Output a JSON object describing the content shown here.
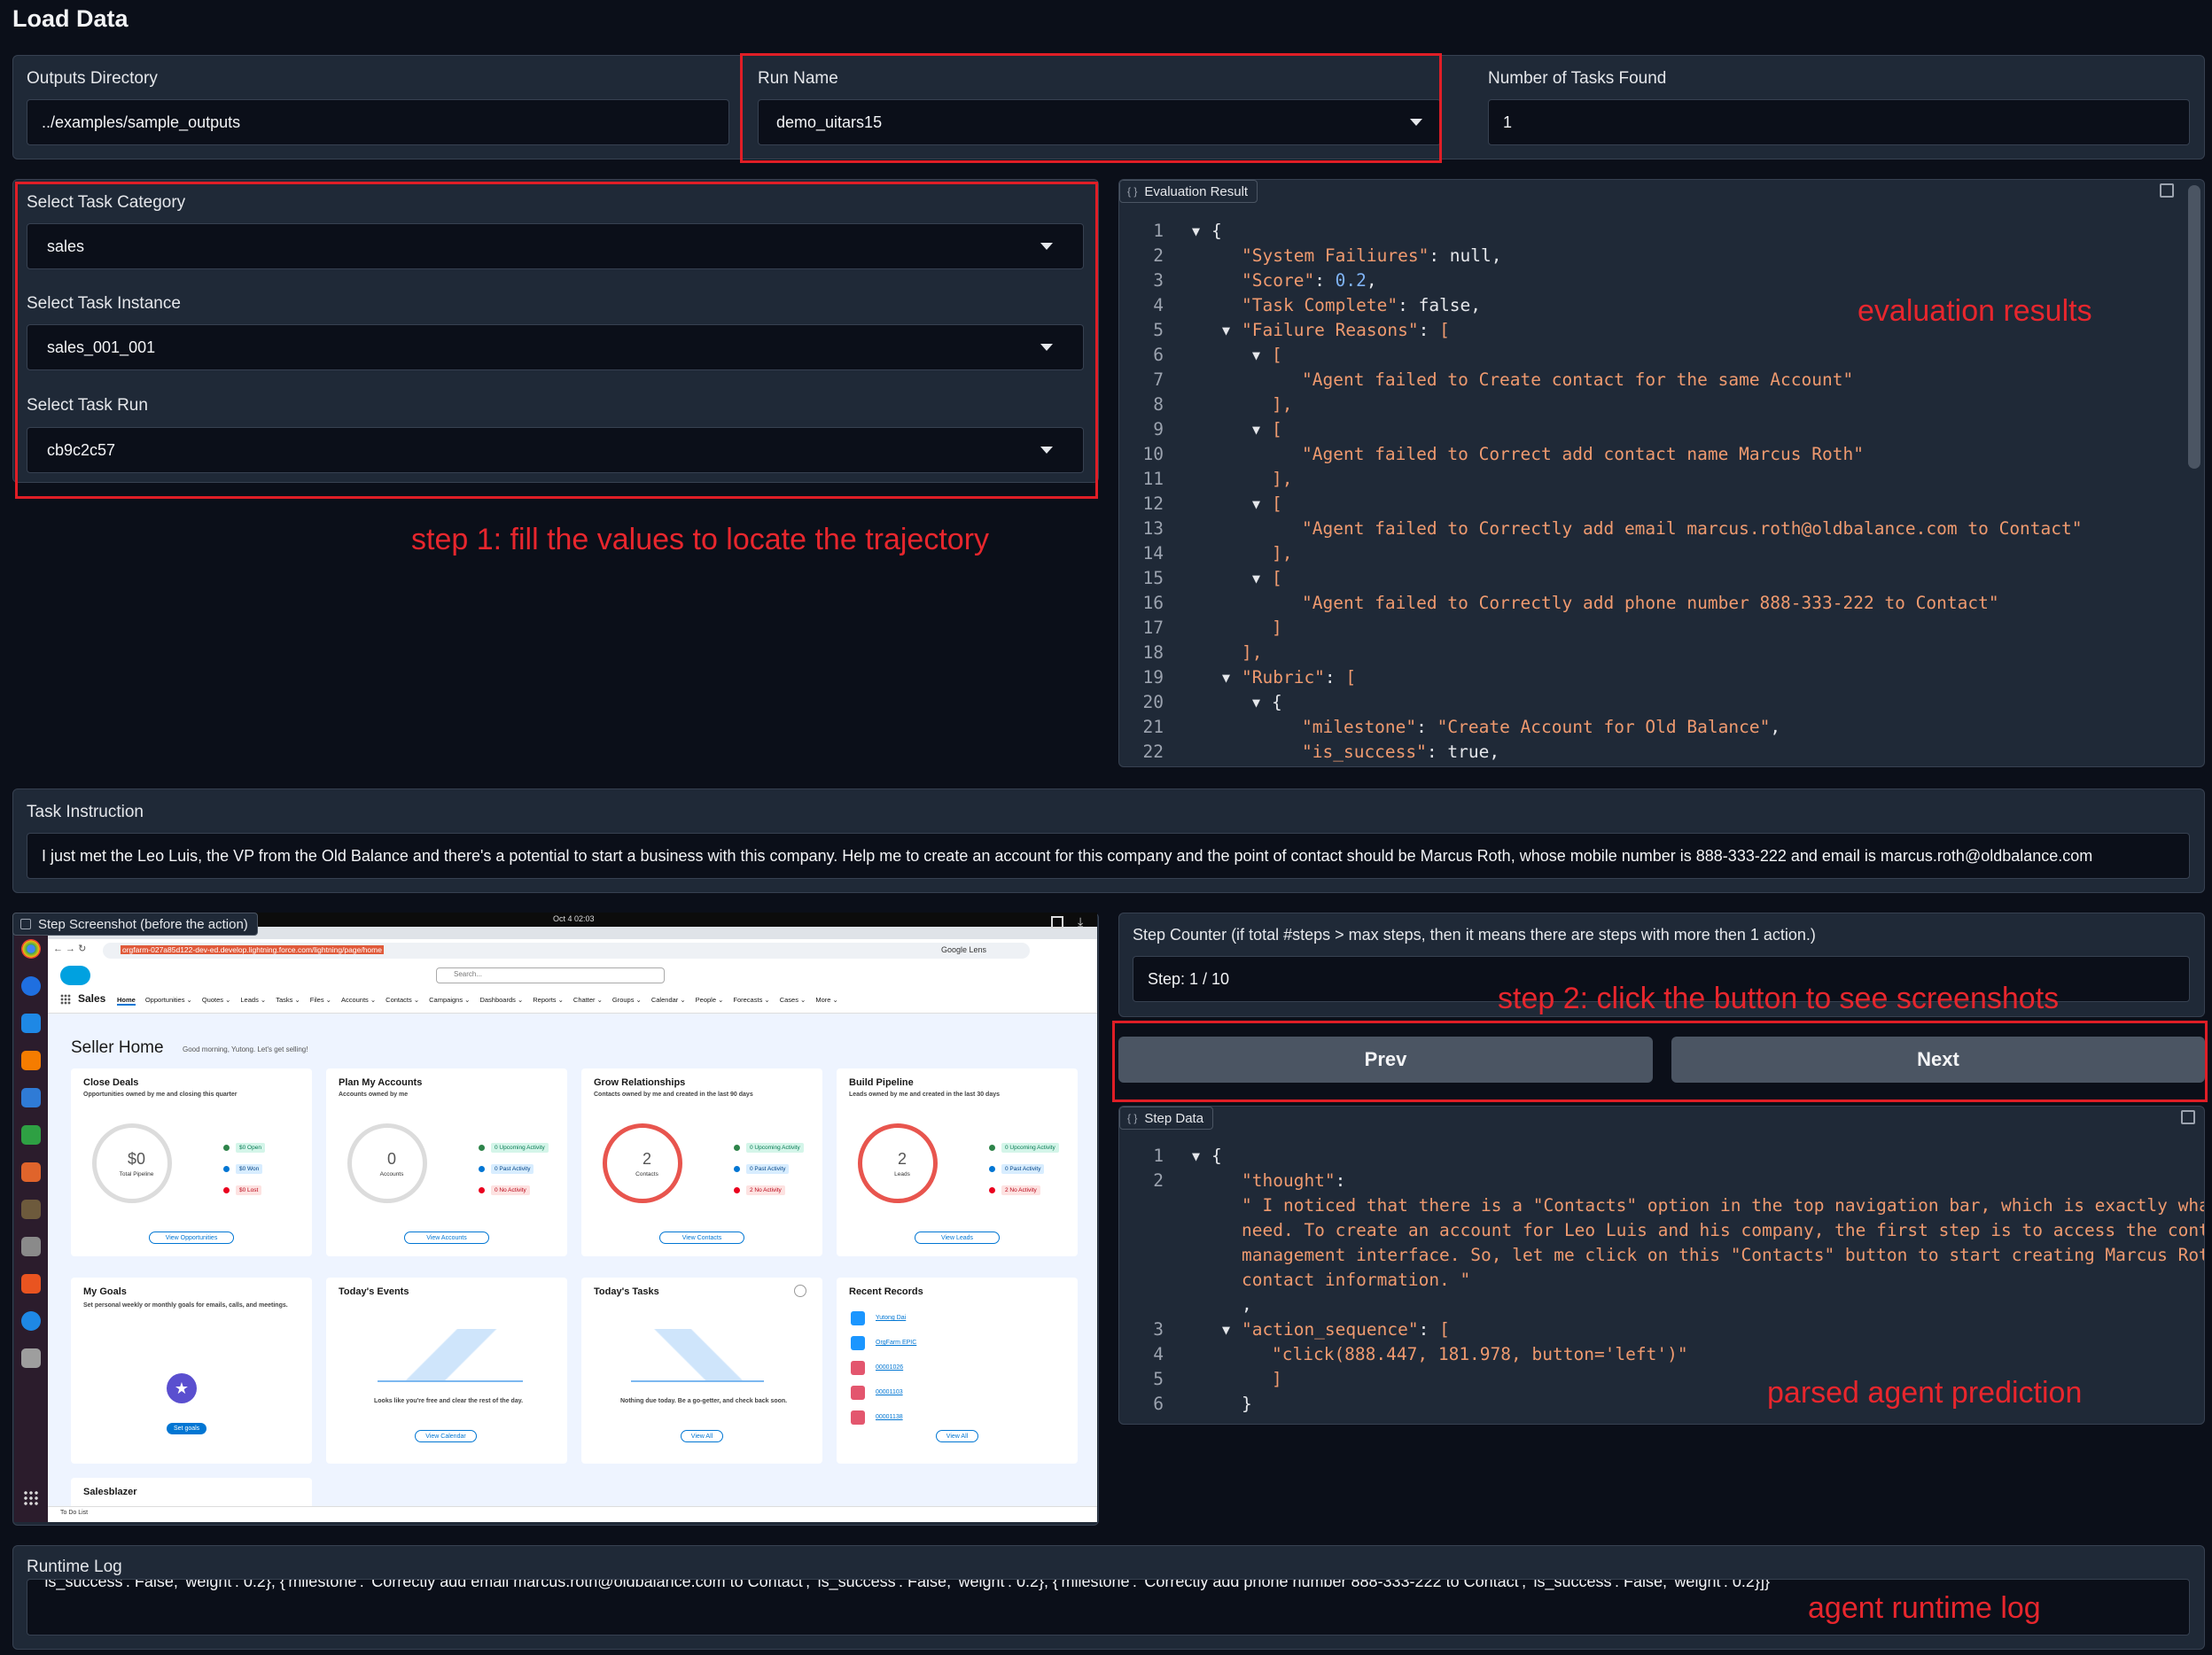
{
  "page_title": "Load Data",
  "outputs_directory": {
    "label": "Outputs Directory",
    "value": "../examples/sample_outputs"
  },
  "run_name": {
    "label": "Run Name",
    "value": "demo_uitars15"
  },
  "num_tasks": {
    "label": "Number of Tasks Found",
    "value": "1"
  },
  "task_category": {
    "label": "Select Task Category",
    "value": "sales"
  },
  "task_instance": {
    "label": "Select Task Instance",
    "value": "sales_001_001"
  },
  "task_run": {
    "label": "Select Task Run",
    "value": "cb9c2c57"
  },
  "evaluation": {
    "label": "Evaluation Result",
    "lines": [
      {
        "n": "1",
        "tri": "▼",
        "indent": 0,
        "html": "<span class='p'>{</span>"
      },
      {
        "n": "2",
        "tri": "",
        "indent": 1,
        "html": "<span class='k'>\"System Failiures\"</span><span class='p'>: null,</span>"
      },
      {
        "n": "3",
        "tri": "",
        "indent": 1,
        "html": "<span class='k'>\"Score\"</span><span class='p'>: </span><span class='n'>0.2</span><span class='p'>,</span>"
      },
      {
        "n": "4",
        "tri": "",
        "indent": 1,
        "html": "<span class='k'>\"Task Complete\"</span><span class='p'>: false,</span>"
      },
      {
        "n": "5",
        "tri": "▼",
        "indent": 1,
        "html": "<span class='k'>\"Failure Reasons\"</span><span class='p'>: </span><span class='s'>[</span>"
      },
      {
        "n": "6",
        "tri": "▼",
        "indent": 2,
        "html": "<span class='s'>[</span>"
      },
      {
        "n": "7",
        "tri": "",
        "indent": 3,
        "html": "<span class='s'>\"Agent failed to Create contact for the same Account\"</span>"
      },
      {
        "n": "8",
        "tri": "",
        "indent": 2,
        "html": "<span class='s'>],</span>"
      },
      {
        "n": "9",
        "tri": "▼",
        "indent": 2,
        "html": "<span class='s'>[</span>"
      },
      {
        "n": "10",
        "tri": "",
        "indent": 3,
        "html": "<span class='s'>\"Agent failed to Correct add contact name Marcus Roth\"</span>"
      },
      {
        "n": "11",
        "tri": "",
        "indent": 2,
        "html": "<span class='s'>],</span>"
      },
      {
        "n": "12",
        "tri": "▼",
        "indent": 2,
        "html": "<span class='s'>[</span>"
      },
      {
        "n": "13",
        "tri": "",
        "indent": 3,
        "html": "<span class='s'>\"Agent failed to Correctly add email marcus.roth@oldbalance.com to Contact\"</span>"
      },
      {
        "n": "14",
        "tri": "",
        "indent": 2,
        "html": "<span class='s'>],</span>"
      },
      {
        "n": "15",
        "tri": "▼",
        "indent": 2,
        "html": "<span class='s'>[</span>"
      },
      {
        "n": "16",
        "tri": "",
        "indent": 3,
        "html": "<span class='s'>\"Agent failed to Correctly add phone number 888-333-222 to Contact\"</span>"
      },
      {
        "n": "17",
        "tri": "",
        "indent": 2,
        "html": "<span class='s'>]</span>"
      },
      {
        "n": "18",
        "tri": "",
        "indent": 1,
        "html": "<span class='s'>],</span>"
      },
      {
        "n": "19",
        "tri": "▼",
        "indent": 1,
        "html": "<span class='k'>\"Rubric\"</span><span class='p'>: </span><span class='s'>[</span>"
      },
      {
        "n": "20",
        "tri": "▼",
        "indent": 2,
        "html": "<span class='p'>{</span>"
      },
      {
        "n": "21",
        "tri": "",
        "indent": 3,
        "html": "<span class='k'>\"milestone\"</span><span class='p'>: </span><span class='s'>\"Create Account for Old Balance\"</span><span class='p'>,</span>"
      },
      {
        "n": "22",
        "tri": "",
        "indent": 3,
        "html": "<span class='k'>\"is_success\"</span><span class='p'>: true,</span>"
      }
    ]
  },
  "task_instruction": {
    "label": "Task Instruction",
    "value": "I just met the Leo Luis, the VP from the Old Balance and there's a potential to start a business with this company. Help me to create an account for this company and the point of contact should be Marcus Roth, whose mobile number is 888-333-222 and email is marcus.roth@oldbalance.com"
  },
  "step_screenshot": {
    "label": "Step Screenshot (before the action)",
    "clock": "Oct 4  02:03",
    "url": "orgfarm-027a85d122-dev-ed.develop.lightning.force.com/lightning/page/home",
    "google_lens": "Google Lens",
    "search_placeholder": "Search...",
    "app_name": "Sales",
    "nav": [
      "Home",
      "Opportunities",
      "Quotes",
      "Leads",
      "Tasks",
      "Files",
      "Accounts",
      "Contacts",
      "Campaigns",
      "Dashboards",
      "Reports",
      "Chatter",
      "Groups",
      "Calendar",
      "People",
      "Forecasts",
      "Cases",
      "More"
    ],
    "home_title": "Seller Home",
    "greeting": "Good morning, Yutong. Let's get selling!",
    "cards": [
      {
        "title": "Close Deals",
        "sub": "Opportunities owned by me and closing this quarter",
        "big": "$0",
        "small": "Total Pipeline",
        "legend": [
          "$0 Open",
          "$0 Won",
          "$0 Lost"
        ],
        "btn": "View Opportunities"
      },
      {
        "title": "Plan My Accounts",
        "sub": "Accounts owned by me",
        "big": "0",
        "small": "Accounts",
        "legend": [
          "0 Upcoming Activity",
          "0 Past Activity",
          "0 No Activity"
        ],
        "btn": "View Accounts"
      },
      {
        "title": "Grow Relationships",
        "sub": "Contacts owned by me and created in the last 90 days",
        "big": "2",
        "small": "Contacts",
        "legend": [
          "0 Upcoming Activity",
          "0 Past Activity",
          "2 No Activity"
        ],
        "btn": "View Contacts"
      },
      {
        "title": "Build Pipeline",
        "sub": "Leads owned by me and created in the last 30 days",
        "big": "2",
        "small": "Leads",
        "legend": [
          "0 Upcoming Activity",
          "0 Past Activity",
          "2 No Activity"
        ],
        "btn": "View Leads"
      }
    ],
    "goals": {
      "title": "My Goals",
      "sub": "Set personal weekly or monthly goals for emails, calls, and meetings.",
      "btn": "Set goals"
    },
    "events": {
      "title": "Today's Events",
      "msg": "Looks like you're free and clear the rest of the day.",
      "btn": "View Calendar"
    },
    "tasks": {
      "title": "Today's Tasks",
      "msg": "Nothing due today. Be a go-getter, and check back soon.",
      "btn": "View All"
    },
    "recent": {
      "title": "Recent Records",
      "items": [
        "Yutong Dai",
        "OrgFarm EPIC",
        "00001026",
        "00001103",
        "00001138"
      ],
      "btn": "View All"
    },
    "salesblazer": "Salesblazer",
    "todo": "To Do List"
  },
  "step_counter": {
    "label": "Step Counter (if total #steps > max steps, then it means there are steps with more then 1 action.)",
    "value": "Step: 1 / 10"
  },
  "buttons": {
    "prev": "Prev",
    "next": "Next"
  },
  "step_data": {
    "label": "Step Data",
    "lines": [
      {
        "n": "1",
        "tri": "▼",
        "indent": 0,
        "html": "<span class='p'>{</span>"
      },
      {
        "n": "2",
        "tri": "",
        "indent": 1,
        "html": "<span class='k'>\"thought\"</span><span class='p'>:</span>"
      },
      {
        "n": "",
        "tri": "",
        "indent": 1,
        "html": "<span class='s'>\" I noticed that there is a \"Contacts\" option in the top navigation bar, which is exactly what I</span>"
      },
      {
        "n": "",
        "tri": "",
        "indent": 1,
        "html": "<span class='s'>need. To create an account for Leo Luis and his company, the first step is to access the contact</span>"
      },
      {
        "n": "",
        "tri": "",
        "indent": 1,
        "html": "<span class='s'>management interface. So, let me click on this \"Contacts\" button to start creating Marcus Roth's</span>"
      },
      {
        "n": "",
        "tri": "",
        "indent": 1,
        "html": "<span class='s'>contact information. \"</span>"
      },
      {
        "n": "",
        "tri": "",
        "indent": 1,
        "html": "<span class='p'>,</span>"
      },
      {
        "n": "3",
        "tri": "▼",
        "indent": 1,
        "html": "<span class='k'>\"action_sequence\"</span><span class='p'>: </span><span class='s'>[</span>"
      },
      {
        "n": "4",
        "tri": "",
        "indent": 2,
        "html": "<span class='s'>\"click(888.447, 181.978, button='left')\"</span>"
      },
      {
        "n": "5",
        "tri": "",
        "indent": 2,
        "html": "<span class='s'>]</span>"
      },
      {
        "n": "6",
        "tri": "",
        "indent": 1,
        "html": "<span class='p'>}</span>"
      }
    ]
  },
  "runtime_log": {
    "label": "Runtime Log",
    "value": "'is_success': False, 'weight': 0.2}, {'milestone': 'Correctly add email marcus.roth@oldbalance.com to Contact', 'is_success': False, 'weight': 0.2}, {'milestone': 'Correctly add phone number 888-333-222 to Contact', 'is_success': False, 'weight': 0.2}]}"
  },
  "annotations": {
    "step1": "step 1: fill the values to locate the trajectory",
    "eval": "evaluation results",
    "step2": "step 2: click the button to see screenshots",
    "parsed": "parsed agent prediction",
    "runtime": "agent runtime log"
  },
  "colors": {
    "background": "#0b0f19",
    "panel": "#1f2937",
    "annotation_red": "#e01e26",
    "button": "#4b5563"
  }
}
